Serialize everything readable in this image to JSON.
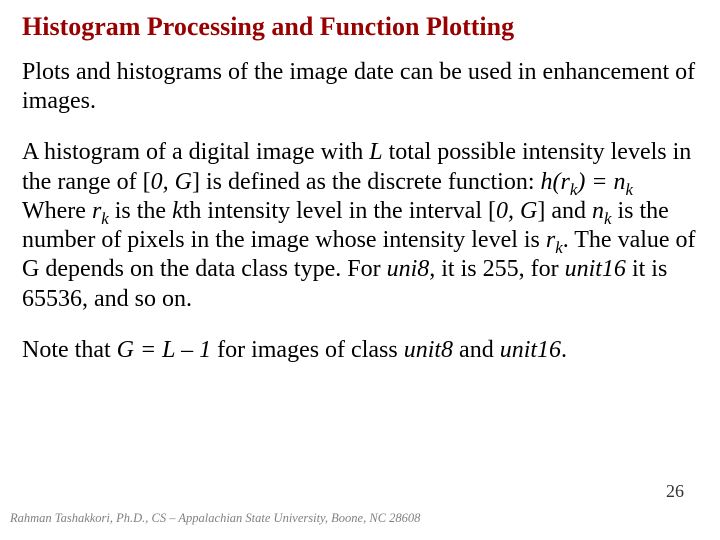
{
  "title": "Histogram Processing and Function Plotting",
  "p1": "Plots and histograms of the image date can be used in enhancement of images.",
  "p2a": "A histogram of a digital image with ",
  "p2_L": "L",
  "p2b": " total possible intensity levels in the range of [",
  "p2_0G": "0, G",
  "p2c": "] is defined as the discrete function: ",
  "p2_func_h": "h(r",
  "p2_func_k1": "k",
  "p2_func_eq": ") = n",
  "p2_func_k2": "k",
  "p3a": "Where ",
  "p3_r": "r",
  "p3_k1": "k",
  "p3b": " is the ",
  "p3_k": "k",
  "p3c": "th intensity level in the interval [",
  "p3_0G": "0, G",
  "p3d": "] and ",
  "p3_n": "n",
  "p3_k2": "k",
  "p3e": " is the number of pixels in the image whose intensity level is ",
  "p3_r2": "r",
  "p3_k3": "k",
  "p3f": ".  The value of G depends on the data class type.  For ",
  "p3_uni8": "uni8,",
  "p3g": " it is 255, for ",
  "p3_unit16": "unit16",
  "p3h": " it is 65536, and so on.",
  "p4a": "Note that ",
  "p4_eq": "G = L – 1",
  "p4b": " for images of class ",
  "p4_u8": "unit8",
  "p4c": " and ",
  "p4_u16": "unit16",
  "p4d": ".",
  "footer": "Rahman Tashakkori, Ph.D., CS – Appalachian State University, Boone, NC 28608",
  "page": "26"
}
